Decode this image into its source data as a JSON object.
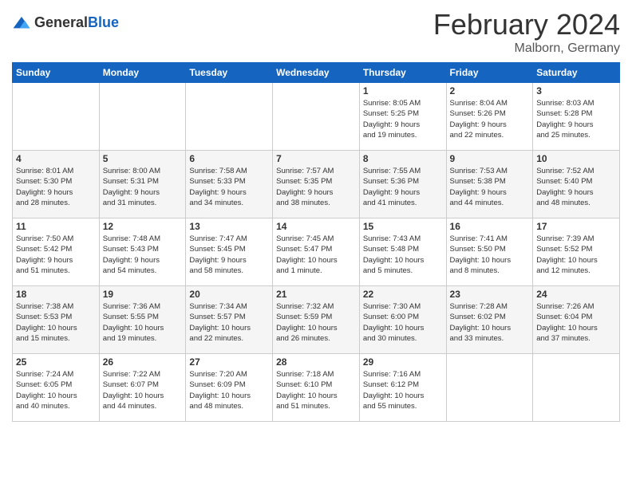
{
  "header": {
    "logo_general": "General",
    "logo_blue": "Blue",
    "month_year": "February 2024",
    "location": "Malborn, Germany"
  },
  "days_of_week": [
    "Sunday",
    "Monday",
    "Tuesday",
    "Wednesday",
    "Thursday",
    "Friday",
    "Saturday"
  ],
  "weeks": [
    [
      {
        "day": "",
        "info": ""
      },
      {
        "day": "",
        "info": ""
      },
      {
        "day": "",
        "info": ""
      },
      {
        "day": "",
        "info": ""
      },
      {
        "day": "1",
        "info": "Sunrise: 8:05 AM\nSunset: 5:25 PM\nDaylight: 9 hours\nand 19 minutes."
      },
      {
        "day": "2",
        "info": "Sunrise: 8:04 AM\nSunset: 5:26 PM\nDaylight: 9 hours\nand 22 minutes."
      },
      {
        "day": "3",
        "info": "Sunrise: 8:03 AM\nSunset: 5:28 PM\nDaylight: 9 hours\nand 25 minutes."
      }
    ],
    [
      {
        "day": "4",
        "info": "Sunrise: 8:01 AM\nSunset: 5:30 PM\nDaylight: 9 hours\nand 28 minutes."
      },
      {
        "day": "5",
        "info": "Sunrise: 8:00 AM\nSunset: 5:31 PM\nDaylight: 9 hours\nand 31 minutes."
      },
      {
        "day": "6",
        "info": "Sunrise: 7:58 AM\nSunset: 5:33 PM\nDaylight: 9 hours\nand 34 minutes."
      },
      {
        "day": "7",
        "info": "Sunrise: 7:57 AM\nSunset: 5:35 PM\nDaylight: 9 hours\nand 38 minutes."
      },
      {
        "day": "8",
        "info": "Sunrise: 7:55 AM\nSunset: 5:36 PM\nDaylight: 9 hours\nand 41 minutes."
      },
      {
        "day": "9",
        "info": "Sunrise: 7:53 AM\nSunset: 5:38 PM\nDaylight: 9 hours\nand 44 minutes."
      },
      {
        "day": "10",
        "info": "Sunrise: 7:52 AM\nSunset: 5:40 PM\nDaylight: 9 hours\nand 48 minutes."
      }
    ],
    [
      {
        "day": "11",
        "info": "Sunrise: 7:50 AM\nSunset: 5:42 PM\nDaylight: 9 hours\nand 51 minutes."
      },
      {
        "day": "12",
        "info": "Sunrise: 7:48 AM\nSunset: 5:43 PM\nDaylight: 9 hours\nand 54 minutes."
      },
      {
        "day": "13",
        "info": "Sunrise: 7:47 AM\nSunset: 5:45 PM\nDaylight: 9 hours\nand 58 minutes."
      },
      {
        "day": "14",
        "info": "Sunrise: 7:45 AM\nSunset: 5:47 PM\nDaylight: 10 hours\nand 1 minute."
      },
      {
        "day": "15",
        "info": "Sunrise: 7:43 AM\nSunset: 5:48 PM\nDaylight: 10 hours\nand 5 minutes."
      },
      {
        "day": "16",
        "info": "Sunrise: 7:41 AM\nSunset: 5:50 PM\nDaylight: 10 hours\nand 8 minutes."
      },
      {
        "day": "17",
        "info": "Sunrise: 7:39 AM\nSunset: 5:52 PM\nDaylight: 10 hours\nand 12 minutes."
      }
    ],
    [
      {
        "day": "18",
        "info": "Sunrise: 7:38 AM\nSunset: 5:53 PM\nDaylight: 10 hours\nand 15 minutes."
      },
      {
        "day": "19",
        "info": "Sunrise: 7:36 AM\nSunset: 5:55 PM\nDaylight: 10 hours\nand 19 minutes."
      },
      {
        "day": "20",
        "info": "Sunrise: 7:34 AM\nSunset: 5:57 PM\nDaylight: 10 hours\nand 22 minutes."
      },
      {
        "day": "21",
        "info": "Sunrise: 7:32 AM\nSunset: 5:59 PM\nDaylight: 10 hours\nand 26 minutes."
      },
      {
        "day": "22",
        "info": "Sunrise: 7:30 AM\nSunset: 6:00 PM\nDaylight: 10 hours\nand 30 minutes."
      },
      {
        "day": "23",
        "info": "Sunrise: 7:28 AM\nSunset: 6:02 PM\nDaylight: 10 hours\nand 33 minutes."
      },
      {
        "day": "24",
        "info": "Sunrise: 7:26 AM\nSunset: 6:04 PM\nDaylight: 10 hours\nand 37 minutes."
      }
    ],
    [
      {
        "day": "25",
        "info": "Sunrise: 7:24 AM\nSunset: 6:05 PM\nDaylight: 10 hours\nand 40 minutes."
      },
      {
        "day": "26",
        "info": "Sunrise: 7:22 AM\nSunset: 6:07 PM\nDaylight: 10 hours\nand 44 minutes."
      },
      {
        "day": "27",
        "info": "Sunrise: 7:20 AM\nSunset: 6:09 PM\nDaylight: 10 hours\nand 48 minutes."
      },
      {
        "day": "28",
        "info": "Sunrise: 7:18 AM\nSunset: 6:10 PM\nDaylight: 10 hours\nand 51 minutes."
      },
      {
        "day": "29",
        "info": "Sunrise: 7:16 AM\nSunset: 6:12 PM\nDaylight: 10 hours\nand 55 minutes."
      },
      {
        "day": "",
        "info": ""
      },
      {
        "day": "",
        "info": ""
      }
    ]
  ]
}
